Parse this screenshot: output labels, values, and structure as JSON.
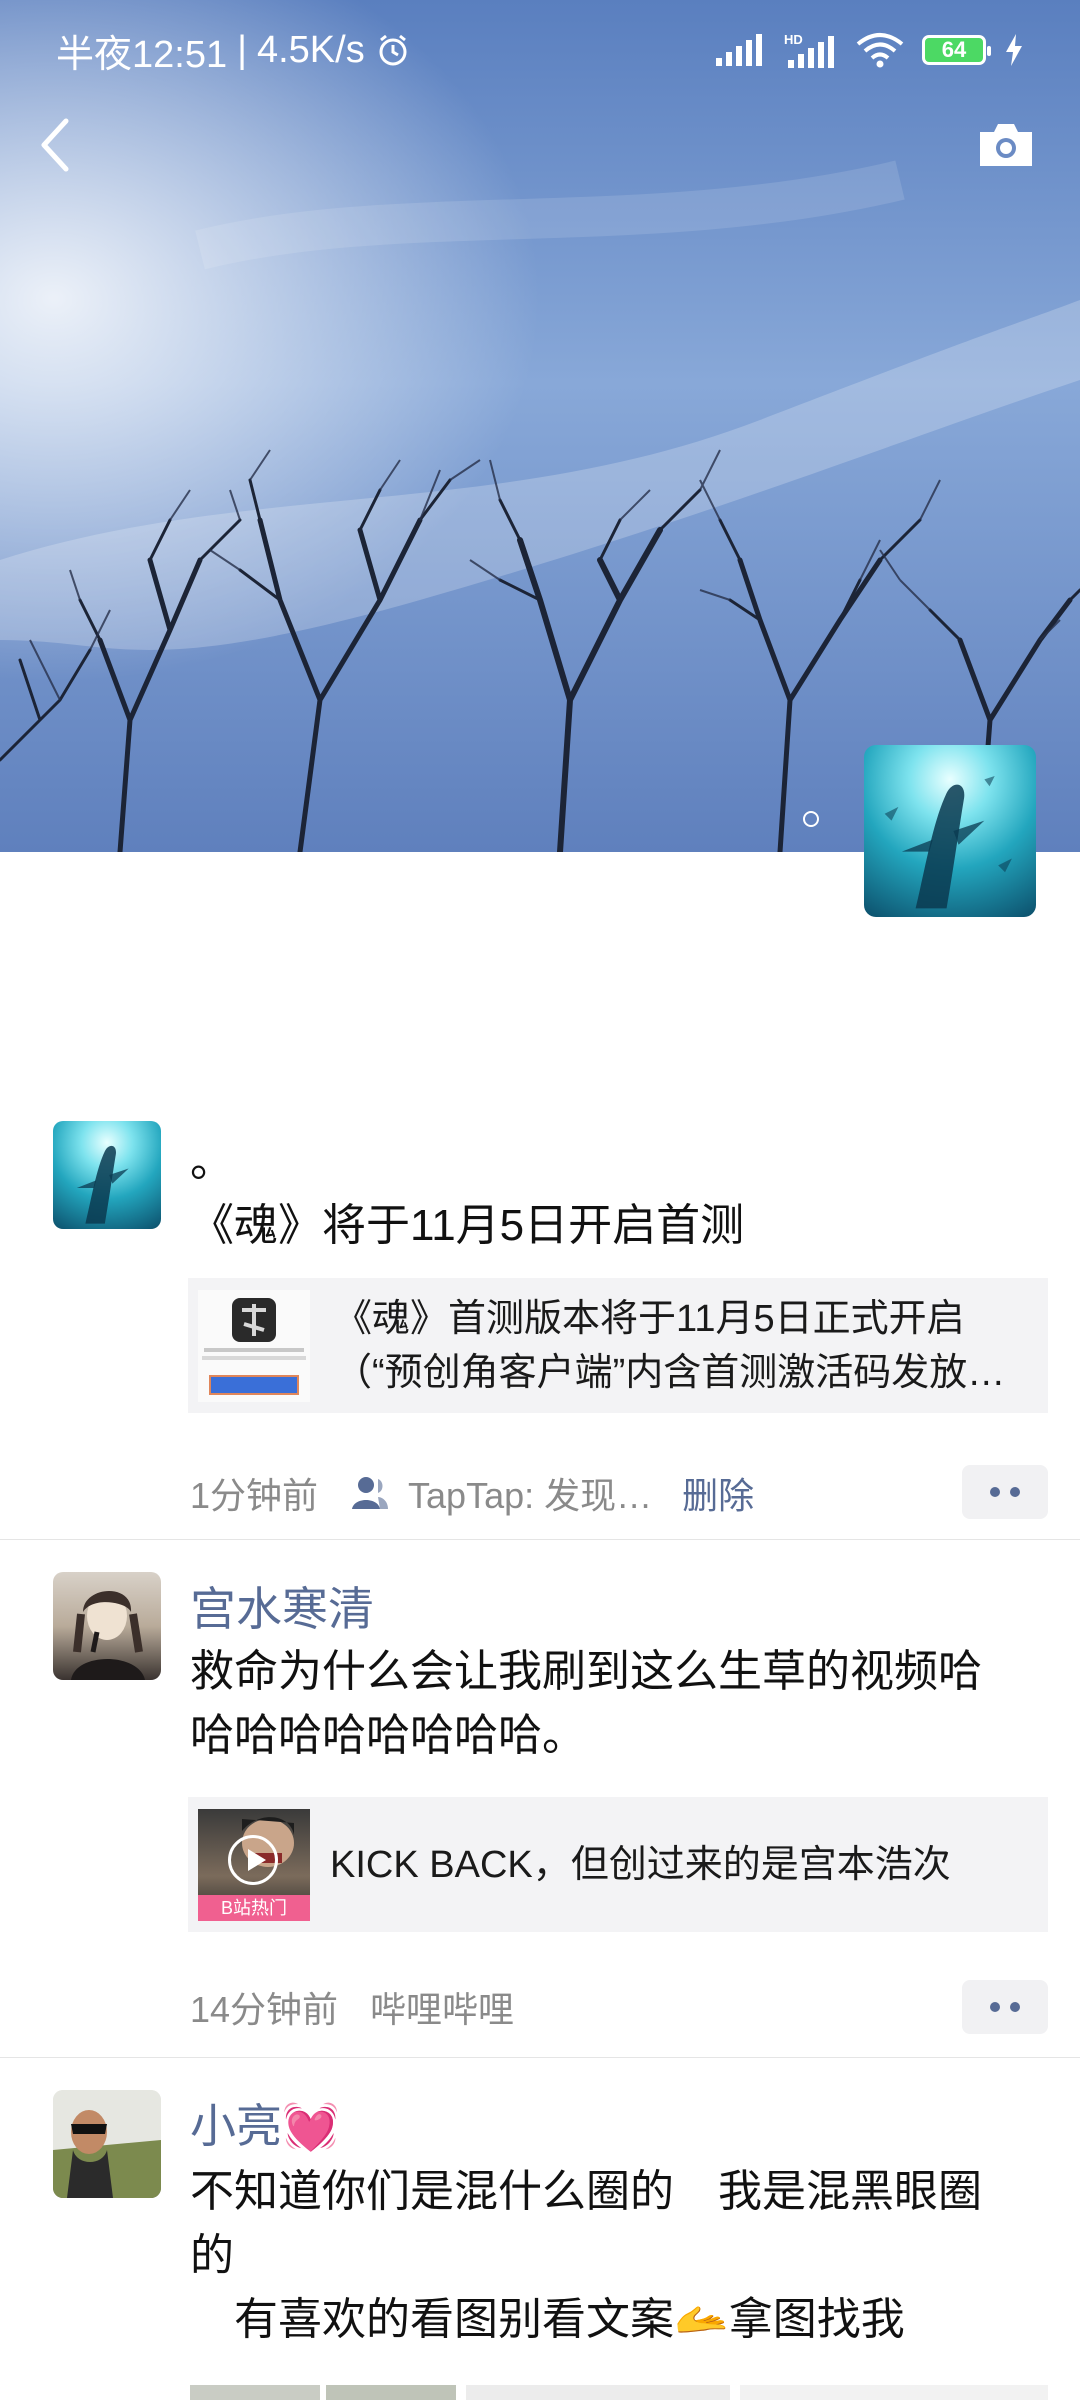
{
  "status_bar": {
    "time": "半夜12:51",
    "speed": "4.5K/s",
    "battery": "64"
  },
  "cover": {
    "back_icon": "chevron-left-icon",
    "camera_icon": "camera-icon"
  },
  "posts": [
    {
      "nickname": "",
      "text_lines": [
        "。",
        "《魂》将于11月5日开启首测"
      ],
      "card": {
        "line1": "《魂》首测版本将于11月5日正式开启",
        "line2": "（“预创角客户端”内含首测激活码发放…"
      },
      "time": "1分钟前",
      "source": "TapTap: 发现…",
      "action": "删除"
    },
    {
      "nickname": "宫水寒清",
      "text_lines": [
        "救命为什么会让我刷到这么生草的视频哈",
        "哈哈哈哈哈哈哈哈。"
      ],
      "card": {
        "line1": "KICK BACK，但创过来的是宫本浩次",
        "badge": "B站热门"
      },
      "time": "14分钟前",
      "source": "哔哩哔哩"
    },
    {
      "nickname": "小亮💓",
      "text_lines": [
        "不知道你们是混什么圈的　我是混黑眼圈",
        "的",
        "　有喜欢的看图别看文案🫴拿图找我"
      ]
    }
  ]
}
